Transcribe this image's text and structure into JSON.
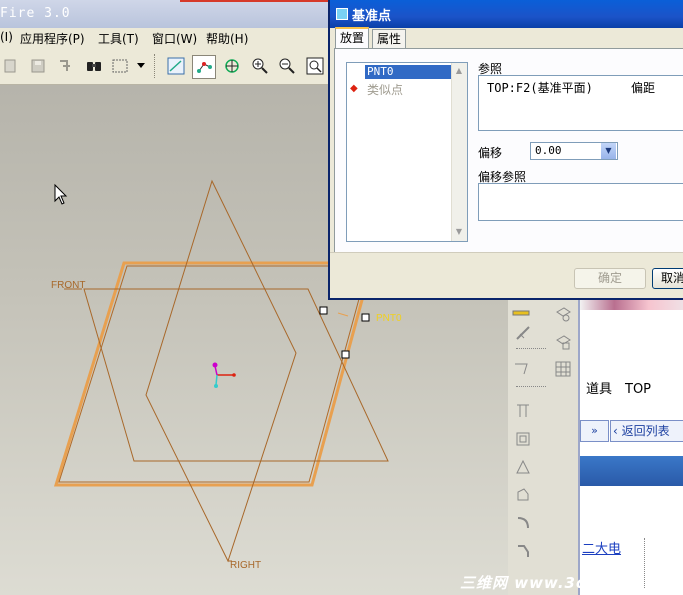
{
  "app": {
    "title": "Fire 3.0",
    "menu": [
      "(I)",
      "应用程序(P)",
      "工具(T)",
      "窗口(W)",
      "帮助(H)"
    ]
  },
  "toolbar_icons": [
    "new-icon",
    "save-icon",
    "regen-icon",
    "binoculars-icon",
    "select-box-icon",
    "sketch-view-icon",
    "datum-point-icon",
    "spin-center-icon",
    "zoom-in-icon",
    "zoom-out-icon",
    "refit-icon"
  ],
  "graphics": {
    "labels": {
      "front": "FRONT",
      "right": "RIGHT",
      "point": "PNT0"
    }
  },
  "dialog": {
    "title": "基准点",
    "tabs": [
      "放置",
      "属性"
    ],
    "active_tab": "放置",
    "point_list": {
      "selected": "PNT0",
      "new_item": "类似点"
    },
    "references_label": "参照",
    "reference_row": {
      "ref": "TOP:F2(基准平面)",
      "type": "偏距"
    },
    "offset_label": "偏移",
    "offset_value": "0.00",
    "offset_refs_label": "偏移参照",
    "ok_label": "确定",
    "cancel_label": "取消"
  },
  "web_panel": {
    "text": "道具　TOP",
    "next_label": "»",
    "back_label": "返回列表",
    "link_text": "二大电"
  },
  "watermark": "三维网 www.3d..."
}
